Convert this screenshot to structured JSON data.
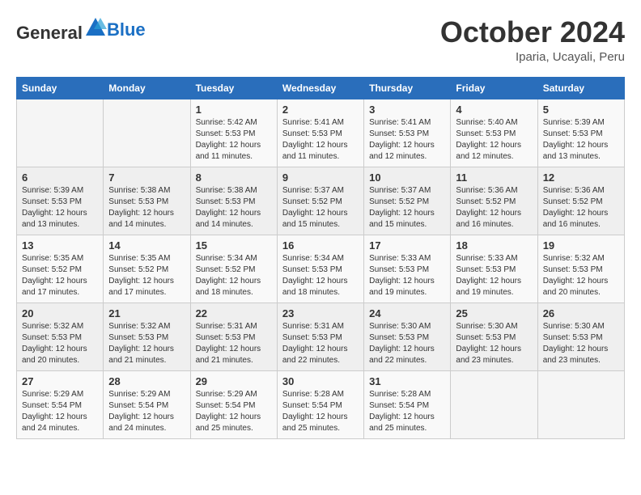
{
  "header": {
    "logo_general": "General",
    "logo_blue": "Blue",
    "month_title": "October 2024",
    "location": "Iparia, Ucayali, Peru"
  },
  "calendar": {
    "days_of_week": [
      "Sunday",
      "Monday",
      "Tuesday",
      "Wednesday",
      "Thursday",
      "Friday",
      "Saturday"
    ],
    "weeks": [
      [
        {
          "day": "",
          "info": ""
        },
        {
          "day": "",
          "info": ""
        },
        {
          "day": "1",
          "info": "Sunrise: 5:42 AM\nSunset: 5:53 PM\nDaylight: 12 hours and 11 minutes."
        },
        {
          "day": "2",
          "info": "Sunrise: 5:41 AM\nSunset: 5:53 PM\nDaylight: 12 hours and 11 minutes."
        },
        {
          "day": "3",
          "info": "Sunrise: 5:41 AM\nSunset: 5:53 PM\nDaylight: 12 hours and 12 minutes."
        },
        {
          "day": "4",
          "info": "Sunrise: 5:40 AM\nSunset: 5:53 PM\nDaylight: 12 hours and 12 minutes."
        },
        {
          "day": "5",
          "info": "Sunrise: 5:39 AM\nSunset: 5:53 PM\nDaylight: 12 hours and 13 minutes."
        }
      ],
      [
        {
          "day": "6",
          "info": "Sunrise: 5:39 AM\nSunset: 5:53 PM\nDaylight: 12 hours and 13 minutes."
        },
        {
          "day": "7",
          "info": "Sunrise: 5:38 AM\nSunset: 5:53 PM\nDaylight: 12 hours and 14 minutes."
        },
        {
          "day": "8",
          "info": "Sunrise: 5:38 AM\nSunset: 5:53 PM\nDaylight: 12 hours and 14 minutes."
        },
        {
          "day": "9",
          "info": "Sunrise: 5:37 AM\nSunset: 5:52 PM\nDaylight: 12 hours and 15 minutes."
        },
        {
          "day": "10",
          "info": "Sunrise: 5:37 AM\nSunset: 5:52 PM\nDaylight: 12 hours and 15 minutes."
        },
        {
          "day": "11",
          "info": "Sunrise: 5:36 AM\nSunset: 5:52 PM\nDaylight: 12 hours and 16 minutes."
        },
        {
          "day": "12",
          "info": "Sunrise: 5:36 AM\nSunset: 5:52 PM\nDaylight: 12 hours and 16 minutes."
        }
      ],
      [
        {
          "day": "13",
          "info": "Sunrise: 5:35 AM\nSunset: 5:52 PM\nDaylight: 12 hours and 17 minutes."
        },
        {
          "day": "14",
          "info": "Sunrise: 5:35 AM\nSunset: 5:52 PM\nDaylight: 12 hours and 17 minutes."
        },
        {
          "day": "15",
          "info": "Sunrise: 5:34 AM\nSunset: 5:52 PM\nDaylight: 12 hours and 18 minutes."
        },
        {
          "day": "16",
          "info": "Sunrise: 5:34 AM\nSunset: 5:53 PM\nDaylight: 12 hours and 18 minutes."
        },
        {
          "day": "17",
          "info": "Sunrise: 5:33 AM\nSunset: 5:53 PM\nDaylight: 12 hours and 19 minutes."
        },
        {
          "day": "18",
          "info": "Sunrise: 5:33 AM\nSunset: 5:53 PM\nDaylight: 12 hours and 19 minutes."
        },
        {
          "day": "19",
          "info": "Sunrise: 5:32 AM\nSunset: 5:53 PM\nDaylight: 12 hours and 20 minutes."
        }
      ],
      [
        {
          "day": "20",
          "info": "Sunrise: 5:32 AM\nSunset: 5:53 PM\nDaylight: 12 hours and 20 minutes."
        },
        {
          "day": "21",
          "info": "Sunrise: 5:32 AM\nSunset: 5:53 PM\nDaylight: 12 hours and 21 minutes."
        },
        {
          "day": "22",
          "info": "Sunrise: 5:31 AM\nSunset: 5:53 PM\nDaylight: 12 hours and 21 minutes."
        },
        {
          "day": "23",
          "info": "Sunrise: 5:31 AM\nSunset: 5:53 PM\nDaylight: 12 hours and 22 minutes."
        },
        {
          "day": "24",
          "info": "Sunrise: 5:30 AM\nSunset: 5:53 PM\nDaylight: 12 hours and 22 minutes."
        },
        {
          "day": "25",
          "info": "Sunrise: 5:30 AM\nSunset: 5:53 PM\nDaylight: 12 hours and 23 minutes."
        },
        {
          "day": "26",
          "info": "Sunrise: 5:30 AM\nSunset: 5:53 PM\nDaylight: 12 hours and 23 minutes."
        }
      ],
      [
        {
          "day": "27",
          "info": "Sunrise: 5:29 AM\nSunset: 5:54 PM\nDaylight: 12 hours and 24 minutes."
        },
        {
          "day": "28",
          "info": "Sunrise: 5:29 AM\nSunset: 5:54 PM\nDaylight: 12 hours and 24 minutes."
        },
        {
          "day": "29",
          "info": "Sunrise: 5:29 AM\nSunset: 5:54 PM\nDaylight: 12 hours and 25 minutes."
        },
        {
          "day": "30",
          "info": "Sunrise: 5:28 AM\nSunset: 5:54 PM\nDaylight: 12 hours and 25 minutes."
        },
        {
          "day": "31",
          "info": "Sunrise: 5:28 AM\nSunset: 5:54 PM\nDaylight: 12 hours and 25 minutes."
        },
        {
          "day": "",
          "info": ""
        },
        {
          "day": "",
          "info": ""
        }
      ]
    ]
  }
}
